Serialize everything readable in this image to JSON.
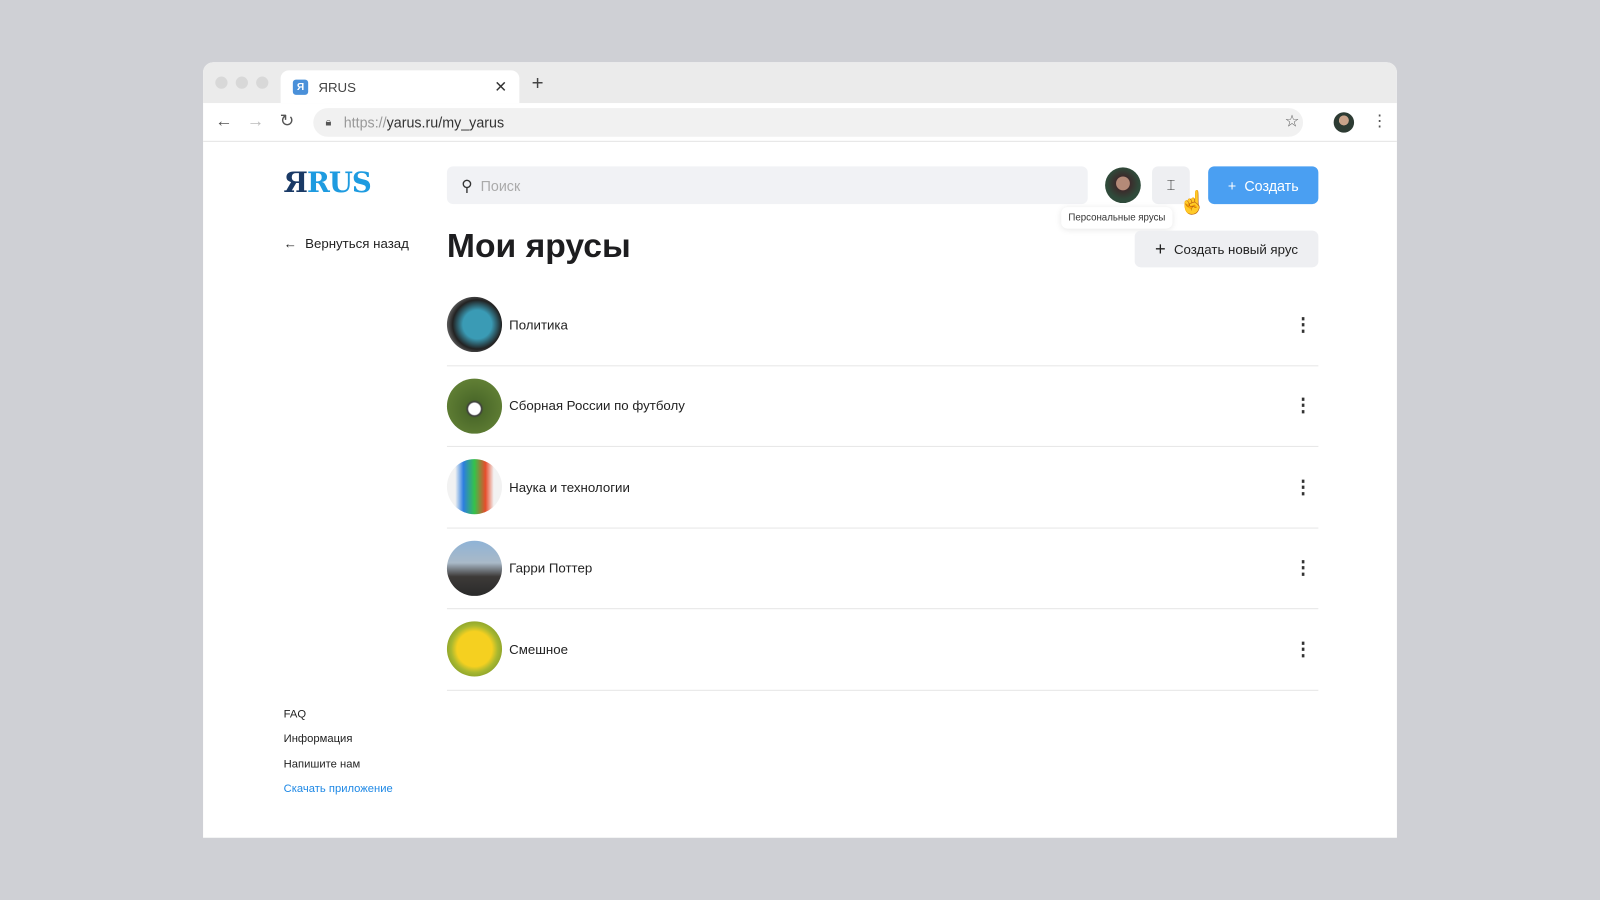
{
  "browser": {
    "tab_title": "ЯRUS",
    "favicon": "Я",
    "url_protocol": "https://",
    "url_rest": "yarus.ru/my_yarus"
  },
  "header": {
    "logo_r": "Я",
    "logo_us": "RUS",
    "search_placeholder": "Поиск",
    "tooltip": "Персональные ярусы",
    "create_label": "Создать"
  },
  "sidebar": {
    "back_label": "Вернуться назад",
    "footer": [
      {
        "label": "FAQ"
      },
      {
        "label": "Информация"
      },
      {
        "label": "Напишите нам"
      },
      {
        "label": "Скачать приложение",
        "color": "#1e88e5"
      }
    ]
  },
  "main": {
    "title": "Мои ярусы",
    "new_label": "Создать новый ярус",
    "items": [
      {
        "name": "Политика"
      },
      {
        "name": "Сборная России по футболу"
      },
      {
        "name": "Наука и технологии"
      },
      {
        "name": "Гарри Поттер"
      },
      {
        "name": "Смешное"
      }
    ]
  },
  "colors": {
    "accent": "#4a9ff2",
    "logo_dark": "#1a3a66",
    "logo_light": "#1e9be0"
  }
}
